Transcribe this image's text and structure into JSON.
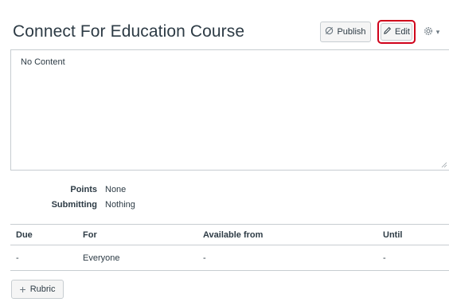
{
  "header": {
    "title": "Connect For Education Course",
    "publish_label": "Publish",
    "edit_label": "Edit",
    "settings_caret": "▾"
  },
  "content": {
    "text": "No Content"
  },
  "details": {
    "points_label": "Points",
    "points_value": "None",
    "submitting_label": "Submitting",
    "submitting_value": "Nothing"
  },
  "table": {
    "headers": [
      "Due",
      "For",
      "Available from",
      "Until"
    ],
    "rows": [
      [
        "-",
        "Everyone",
        "-",
        "-"
      ]
    ]
  },
  "rubric": {
    "plus": "+",
    "label": "Rubric"
  },
  "colors": {
    "highlight": "#d0021b",
    "border": "#c7cdd1",
    "text": "#2d3b45"
  },
  "icons": {
    "publish": "publish-disabled-icon",
    "edit": "pencil-icon",
    "settings": "gear-icon",
    "rubric": "plus-icon"
  }
}
